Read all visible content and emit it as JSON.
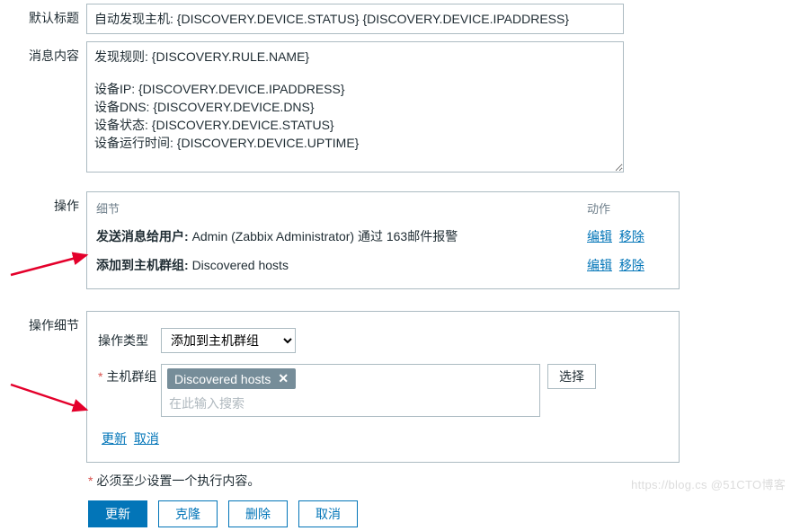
{
  "labels": {
    "default_subject": "默认标题",
    "message": "消息内容",
    "operations": "操作",
    "operation_detail": "操作细节",
    "operation_type": "操作类型",
    "host_group": "主机群组"
  },
  "default_subject": "自动发现主机: {DISCOVERY.DEVICE.STATUS} {DISCOVERY.DEVICE.IPADDRESS}",
  "message_value": "发现规则: {DISCOVERY.RULE.NAME}\n\n设备IP: {DISCOVERY.DEVICE.IPADDRESS}\n设备DNS: {DISCOVERY.DEVICE.DNS}\n设备状态: {DISCOVERY.DEVICE.STATUS}\n设备运行时间: {DISCOVERY.DEVICE.UPTIME}",
  "ops": {
    "col_details": "细节",
    "col_action": "动作",
    "rows": [
      {
        "label": "发送消息给用户:",
        "value": "Admin (Zabbix Administrator) 通过 163邮件报警"
      },
      {
        "label": "添加到主机群组:",
        "value": "Discovered hosts"
      }
    ],
    "edit": "编辑",
    "remove": "移除"
  },
  "detail": {
    "type_selected": "添加到主机群组",
    "group_tag": "Discovered hosts",
    "search_placeholder": "在此输入搜索",
    "select_btn": "选择",
    "update": "更新",
    "cancel": "取消"
  },
  "footer": {
    "req_note": "必须至少设置一个执行内容。",
    "update": "更新",
    "clone": "克隆",
    "delete": "删除",
    "cancel": "取消"
  },
  "watermark": "https://blog.cs @51CTO博客"
}
